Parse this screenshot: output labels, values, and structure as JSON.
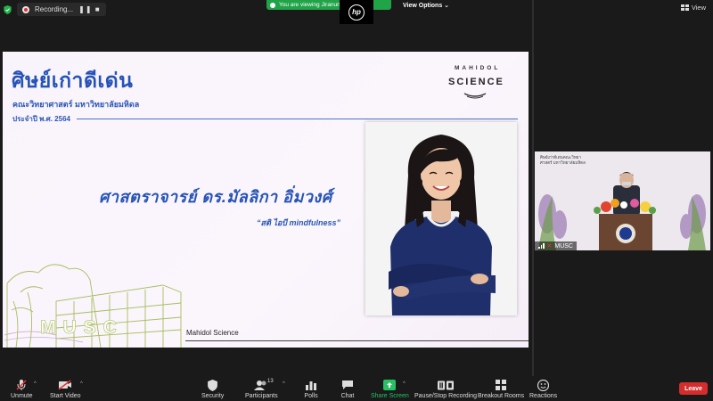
{
  "recording": {
    "label": "Recording...",
    "controls": "❚❚ ■"
  },
  "share_banner": {
    "text": "You are viewing Jiranun's screen"
  },
  "view_options": "View Options ⌄",
  "view_button": "View",
  "slide": {
    "title": "ศิษย์เก่าดีเด่น",
    "faculty": "คณะวิทยาศาสตร์ มหาวิทยาลัยมหิดล",
    "year": "ประจำปี พ.ศ. 2564",
    "logo_top": "MAHIDOL",
    "logo_main": "SCIENCE",
    "professor": "ศาสตราจารย์ ดร.มัลลิกา อิ่มวงศ์",
    "quote": "“สติ ไอบี mindfulness”",
    "watermark": "MUSC",
    "footer": "Mahidol Science"
  },
  "speaker": {
    "badge_line1": "ศิษย์เก่าดีเด่นคณะวิทยา",
    "badge_line2": "ศาสตร์ มหาวิทยาลัยมหิดล",
    "name": "MUSC"
  },
  "toolbar": {
    "unmute": "Unmute",
    "start_video": "Start Video",
    "security": "Security",
    "participants": "Participants",
    "participants_count": "13",
    "polls": "Polls",
    "chat": "Chat",
    "share_screen": "Share Screen",
    "recording": "Pause/Stop Recording",
    "breakout": "Breakout Rooms",
    "reactions": "Reactions",
    "leave": "Leave"
  },
  "colors": {
    "accent_blue": "#2653b8",
    "share_green": "#21a348",
    "leave_red": "#d42d2d"
  }
}
